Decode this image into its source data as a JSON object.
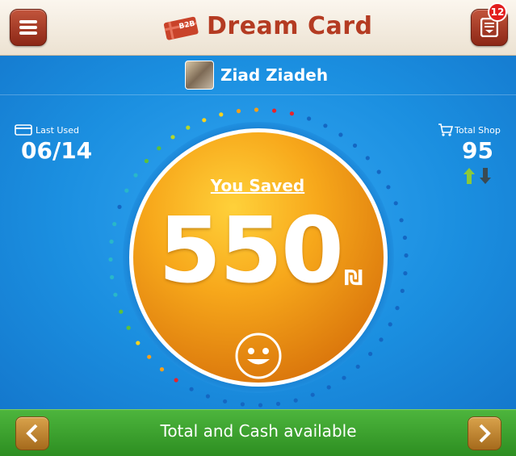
{
  "header": {
    "title": "Dream Card",
    "logo_text": "B2B",
    "notification_count": "12"
  },
  "user": {
    "name": "Ziad Ziadeh"
  },
  "last_used": {
    "label": "Last Used",
    "value": "06/14"
  },
  "total_shop": {
    "label": "Total Shop",
    "value": "95"
  },
  "savings": {
    "label": "You Saved",
    "amount": "550",
    "currency": "₪"
  },
  "footer": {
    "title": "Total and Cash available"
  },
  "icons": {
    "menu": "hamburger-icon",
    "inbox": "inbox-icon",
    "card": "credit-card-icon",
    "cart": "shopping-cart-icon",
    "trend": "up-down-arrows-icon",
    "mood": "smiley-icon",
    "prev": "chevron-left-icon",
    "next": "chevron-right-icon"
  },
  "colors": {
    "header_accent": "#b43b22",
    "main_blue": "#1b8fe0",
    "gauge_orange": "#f39a12",
    "footer_green": "#3aa52e",
    "badge_red": "#e21d1d"
  }
}
